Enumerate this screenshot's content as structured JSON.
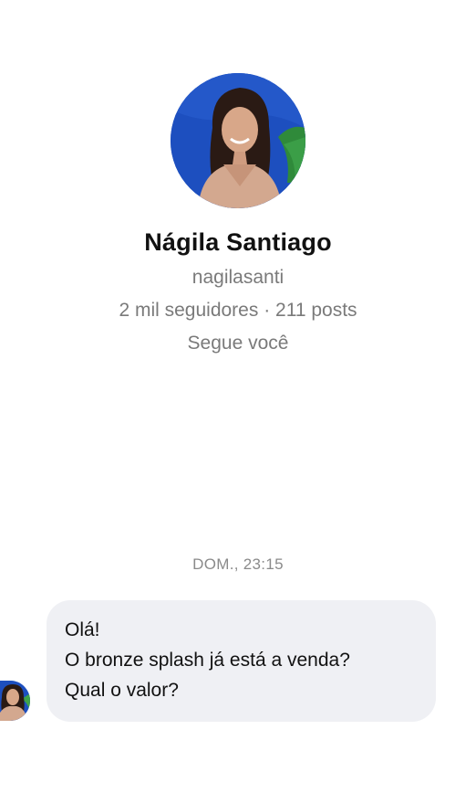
{
  "profile": {
    "display_name": "Nágila Santiago",
    "username": "nagilasanti",
    "stats": "2 mil seguidores · 211 posts",
    "follow_status": "Segue você"
  },
  "thread": {
    "timestamp": "DOM., 23:15",
    "messages": [
      {
        "sender": "Nágila Santiago",
        "lines": [
          "Olá!",
          "O bronze splash já está a venda?",
          "Qual o valor?"
        ]
      }
    ]
  },
  "colors": {
    "background": "#ffffff",
    "bubble": "#eff0f4",
    "secondary_text": "#7a7a7a",
    "primary_text": "#111111"
  },
  "icons": [
    "profile-avatar",
    "sender-avatar"
  ]
}
